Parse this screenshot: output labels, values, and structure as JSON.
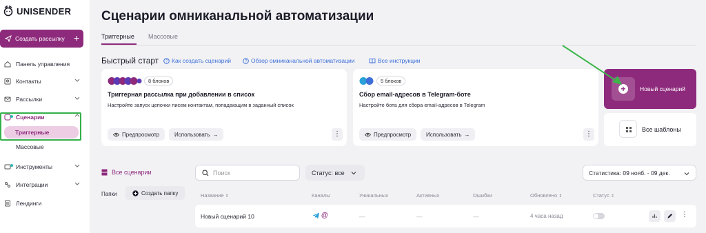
{
  "sidebar": {
    "logo_text": "UNISENDER",
    "create_button": "Создать рассылку",
    "items": [
      {
        "label": "Панель управления",
        "icon": "home-icon"
      },
      {
        "label": "Контакты",
        "icon": "contacts-icon"
      },
      {
        "label": "Рассылки",
        "icon": "mail-icon"
      },
      {
        "label": "Сценарии",
        "icon": "scenario-icon"
      },
      {
        "label": "Инструменты",
        "icon": "tools-icon"
      },
      {
        "label": "Интеграции",
        "icon": "integrations-icon"
      },
      {
        "label": "Лендинги",
        "icon": "landing-icon"
      }
    ],
    "sub_items": [
      "Триггерные",
      "Массовые"
    ],
    "accent": "#8e2a7c"
  },
  "page": {
    "title": "Сценарии омниканальной автоматизации",
    "tabs": [
      "Триггерные",
      "Массовые"
    ]
  },
  "quick_start": {
    "title": "Быстрый старт",
    "links": [
      "Как создать сценарий",
      "Обзор омниканальной автоматизации",
      "Все инструкции"
    ],
    "cards": [
      {
        "badge": "8 блоков",
        "title": "Триггерная рассылка при добавлении в список",
        "desc": "Настройте запуск цепочки писем контактам, попадающим в заданный список",
        "preview": "Предпросмотр",
        "use": "Использовать"
      },
      {
        "badge": "5 блоков",
        "title": "Сбор email-адресов в Telegram-боте",
        "desc": "Настройте бота для сбора email-адресов в Telegram",
        "preview": "Предпросмотр",
        "use": "Использовать"
      }
    ],
    "new_scenario": "Новый сценарий",
    "all_templates": "Все шаблоны"
  },
  "list": {
    "all_scenarios": "Все сценарии",
    "folders_label": "Папки",
    "create_folder": "Создать папку",
    "search_placeholder": "Поиск",
    "status_filter": "Статус: все",
    "stats_period": "Статистика: 09 нояб. - 09 дек.",
    "columns": [
      "Название",
      "Каналы",
      "Уникальных",
      "Активных",
      "Ошибки",
      "Обновлено",
      "Статус"
    ],
    "rows": [
      {
        "name": "Новый сценарий 10",
        "unique": "—",
        "active": "—",
        "errors": "—",
        "updated": "4 часа назад"
      }
    ]
  }
}
